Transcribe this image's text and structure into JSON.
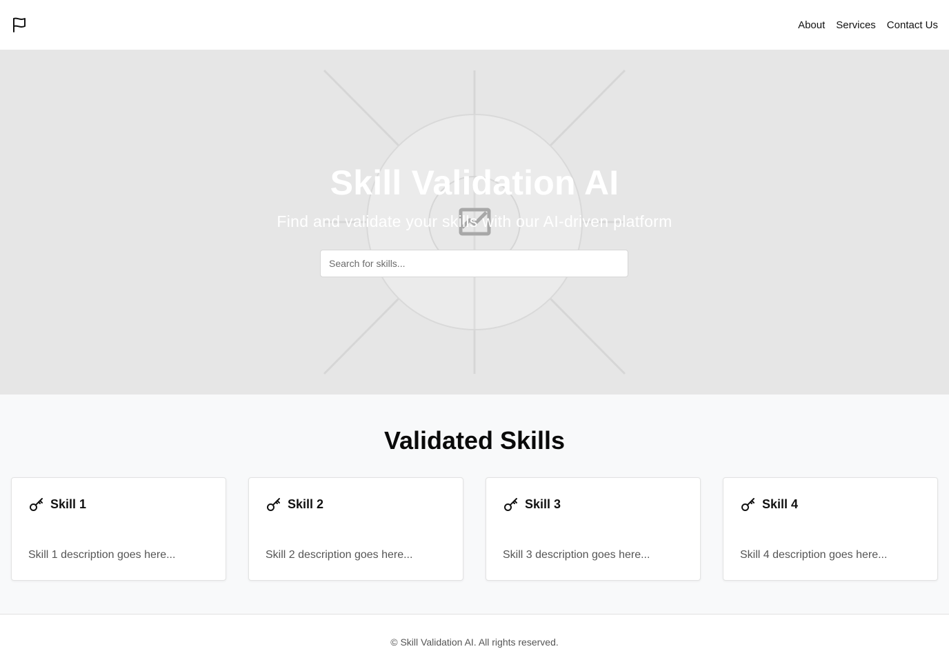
{
  "header": {
    "logo_icon": "flag-icon",
    "nav": [
      {
        "label": "About"
      },
      {
        "label": "Services"
      },
      {
        "label": "Contact Us"
      }
    ]
  },
  "hero": {
    "title": "Skill Validation AI",
    "subtitle": "Find and validate your skills with our AI-driven platform",
    "search_placeholder": "Search for skills...",
    "background_icon": "image-placeholder-icon",
    "background_color": "#e6e6e6"
  },
  "skills": {
    "title": "Validated Skills",
    "card_icon": "key-icon",
    "items": [
      {
        "title": "Skill 1",
        "description": "Skill 1 description goes here..."
      },
      {
        "title": "Skill 2",
        "description": "Skill 2 description goes here..."
      },
      {
        "title": "Skill 3",
        "description": "Skill 3 description goes here..."
      },
      {
        "title": "Skill 4",
        "description": "Skill 4 description goes here..."
      }
    ]
  },
  "footer": {
    "text": "© Skill Validation AI. All rights reserved."
  }
}
